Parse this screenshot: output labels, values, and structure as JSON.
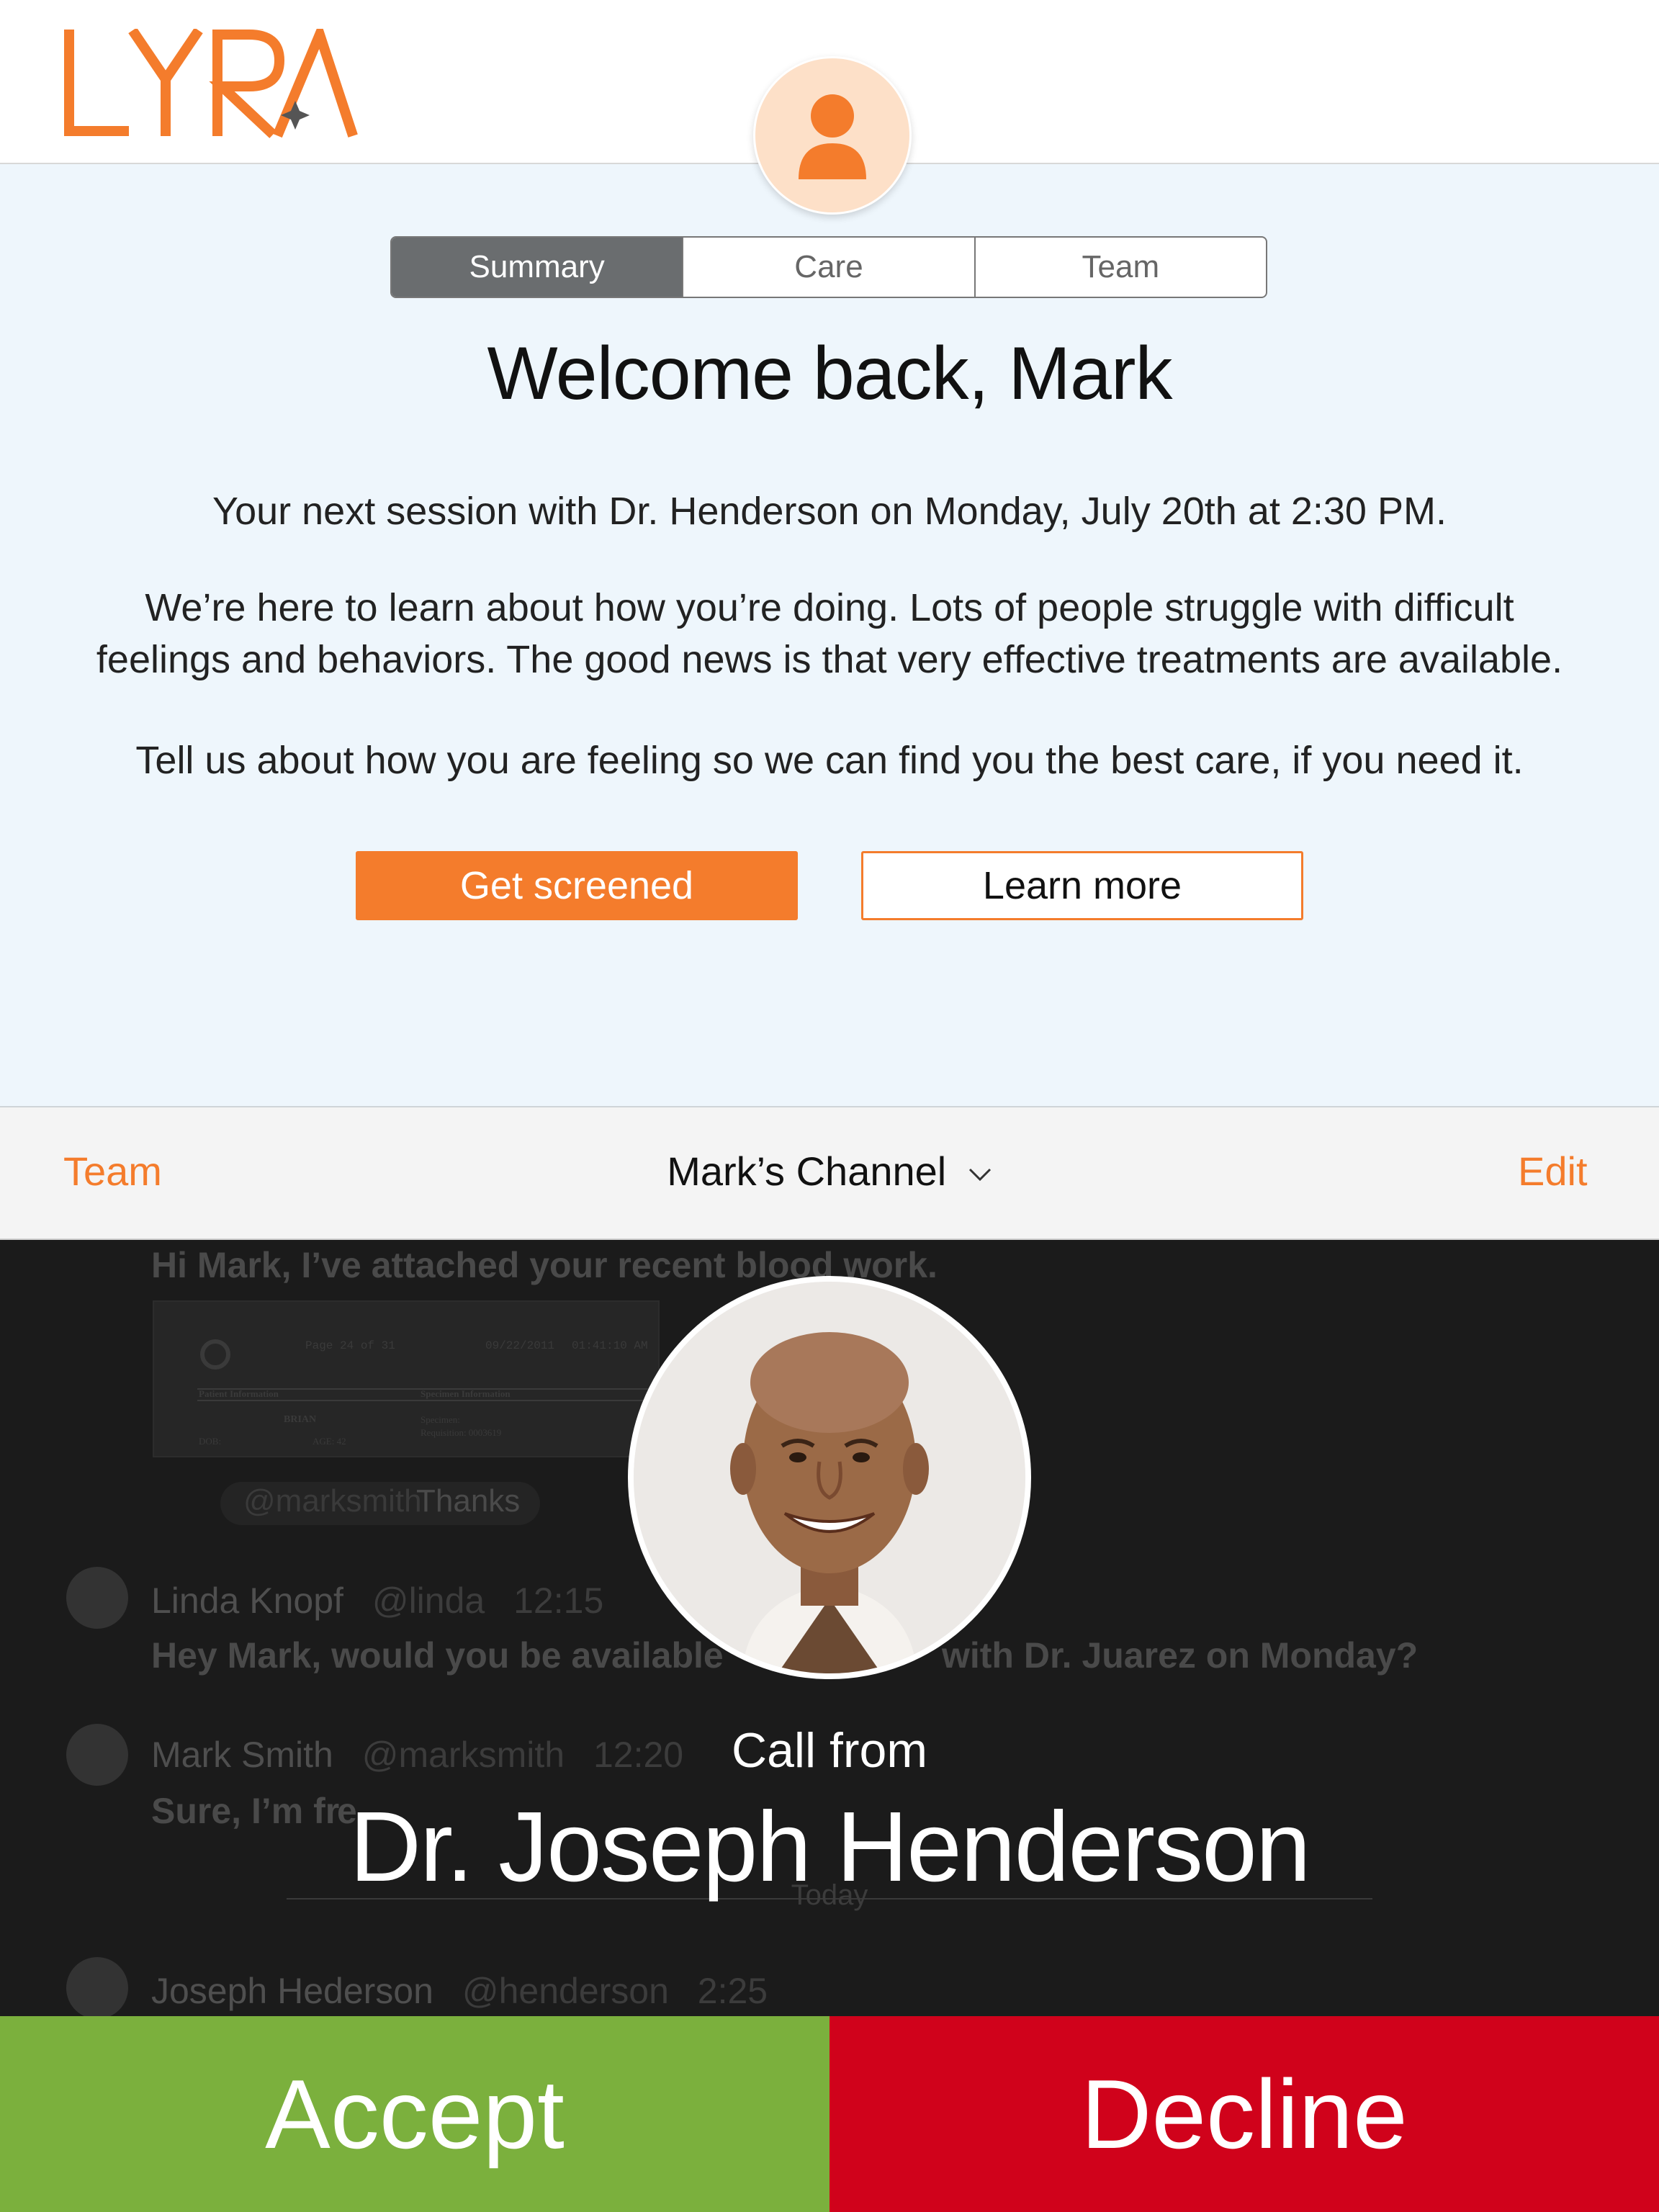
{
  "brand": {
    "name": "LYRA",
    "accent": "#f47c2c"
  },
  "tabs": [
    {
      "label": "Summary",
      "active": true
    },
    {
      "label": "Care",
      "active": false
    },
    {
      "label": "Team",
      "active": false
    }
  ],
  "summary": {
    "welcome": "Welcome back, Mark",
    "next_session": "Your next session with Dr. Henderson on Monday, July 20th at 2:30 PM.",
    "intro_line1": "We’re here to learn about how you’re doing. Lots of people struggle with difficult",
    "intro_line2": "feelings and behaviors. The good news is that very effective treatments are available.",
    "cta_text": "Tell us about how you are feeling so we can find you the best care, if you need it.",
    "get_screened": "Get screened",
    "learn_more": "Learn more"
  },
  "channel_bar": {
    "left": "Team",
    "title": "Mark’s Channel",
    "right": "Edit"
  },
  "chat": {
    "attachment_msg": "Hi Mark, I’ve attached your recent blood work.",
    "doc_page": "Page 24 of 31",
    "doc_date": "09/22/2011",
    "doc_time": "01:41:10 AM",
    "doc_patient_header": "Patient Information",
    "doc_specimen_header": "Specimen Information",
    "doc_patient_name": "BRIAN",
    "doc_dob": "DOB:",
    "doc_age": "AGE: 42",
    "doc_specimen": "Specimen:",
    "doc_requisition": "Requisition: 0003619",
    "thanks_mention": "@marksmith",
    "thanks_text": "Thanks",
    "messages": [
      {
        "name": "Linda Knopf",
        "handle": "@linda",
        "time": "12:15",
        "text": "Hey Mark, would you be available",
        "text_tail": "with Dr. Juarez on Monday?"
      },
      {
        "name": "Mark Smith",
        "handle": "@marksmith",
        "time": "12:20",
        "text": "Sure, I’m fr",
        "text_tail": "e."
      },
      {
        "name": "Joseph Hederson",
        "handle": "@henderson",
        "time": "2:25"
      }
    ],
    "divider": "Today"
  },
  "call": {
    "label": "Call from",
    "caller": "Dr. Joseph Henderson",
    "accept": "Accept",
    "decline": "Decline",
    "accept_color": "#7bb03d",
    "decline_color": "#d0021b"
  }
}
